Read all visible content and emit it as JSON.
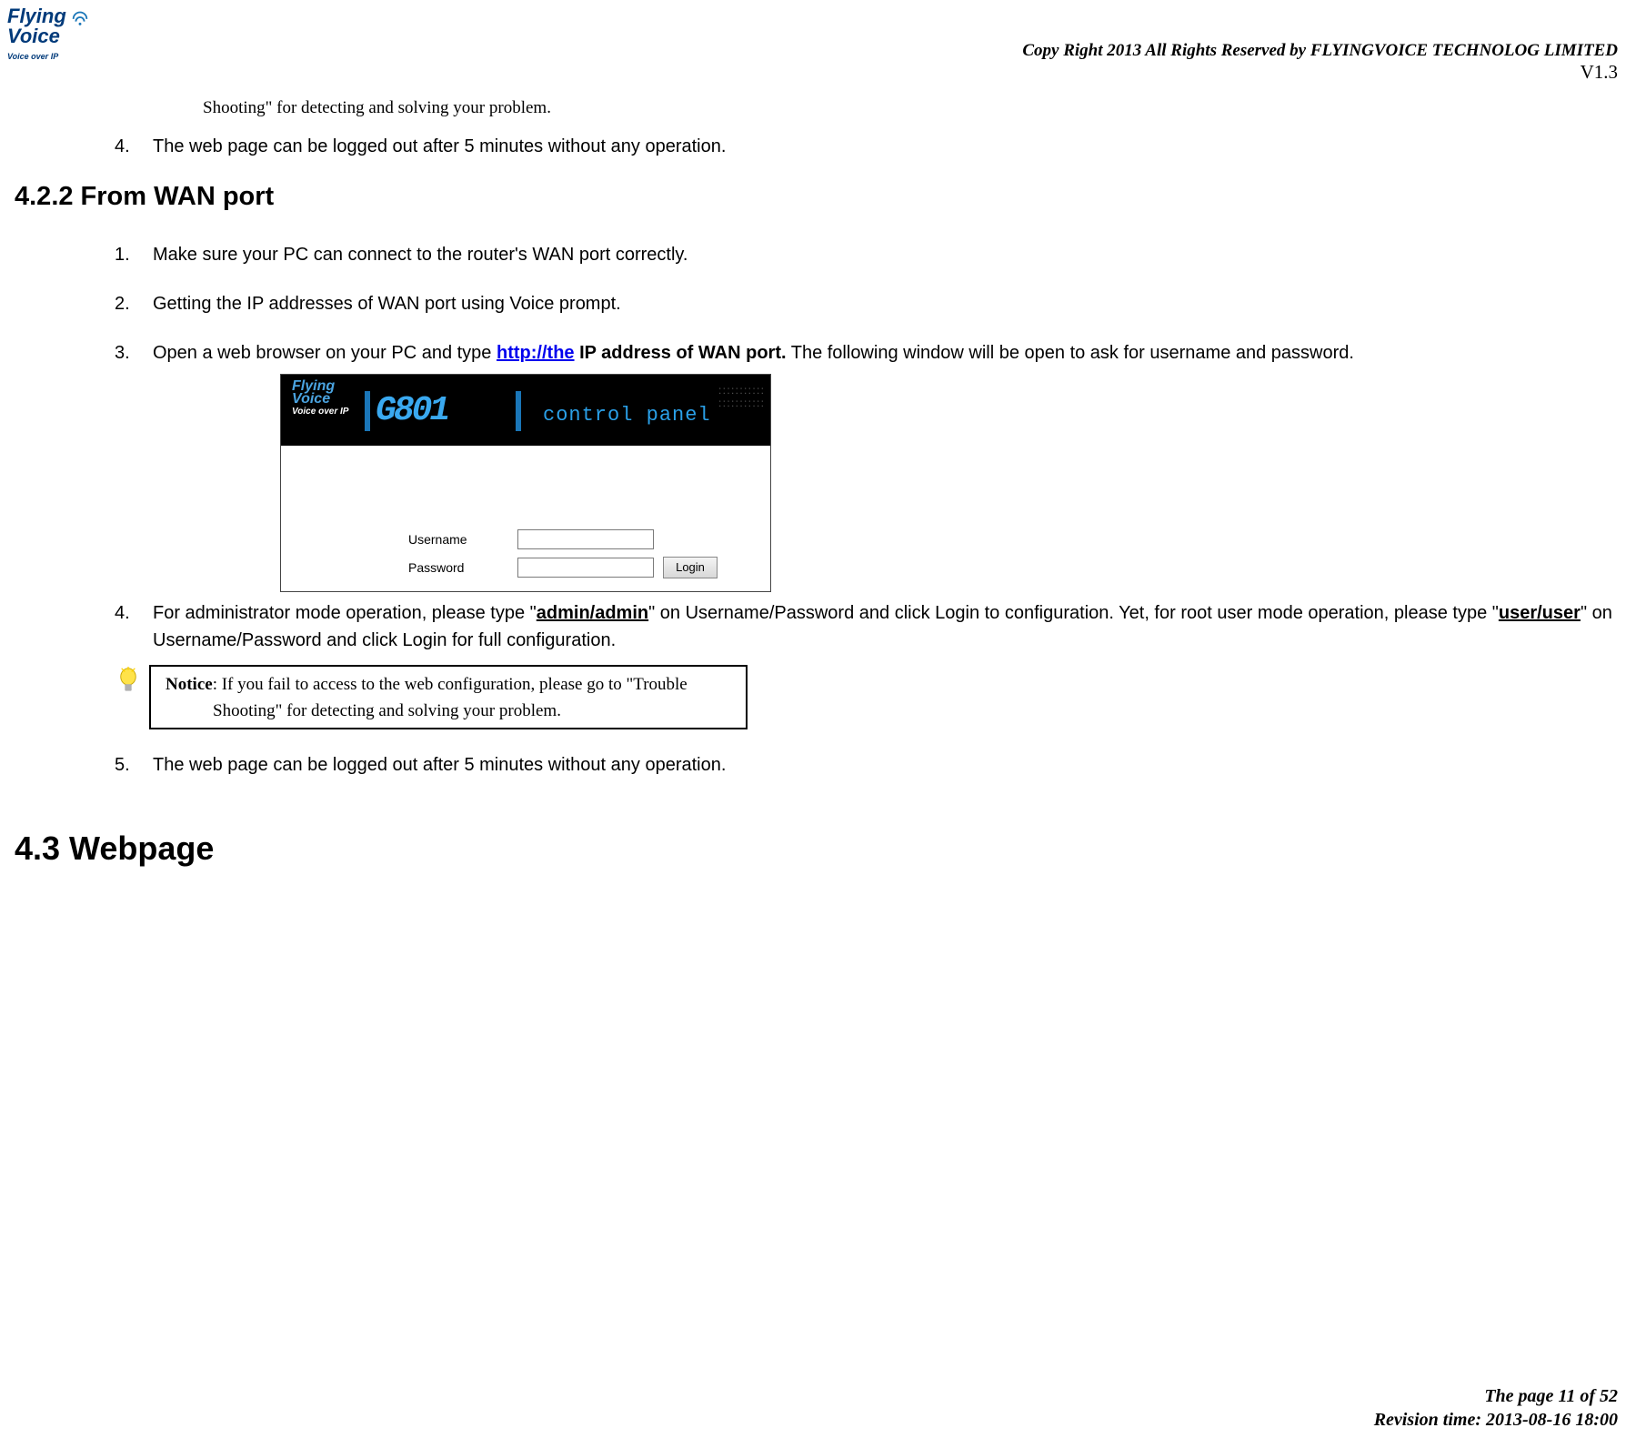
{
  "header": {
    "logo_line1": "Flying",
    "logo_line2": "Voice",
    "logo_sub": "Voice over IP",
    "copyright": "Copy Right 2013 All Rights Reserved by FLYINGVOICE TECHNOLOG LIMITED",
    "version": "V1.3"
  },
  "top_fragment": "Shooting\" for detecting and solving your problem.",
  "item4_top": {
    "num": "4.",
    "text": "The web page can be logged out after 5 minutes without any operation."
  },
  "section_title": "4.2.2 From WAN port",
  "wan_list": {
    "i1": {
      "num": "1.",
      "text": "Make sure your PC can connect to the router's WAN port correctly."
    },
    "i2": {
      "num": "2.",
      "text": "Getting the IP addresses of WAN port using Voice prompt."
    },
    "i3": {
      "num": "3.",
      "pre": "Open a web browser on your PC and type ",
      "link": "http://the",
      "mid": " IP address of WAN port.",
      "post": " The following window will be open to ask for username and password."
    },
    "i4": {
      "num": "4.",
      "pre": "For administrator mode operation, please type \"",
      "cred1": "admin/admin",
      "mid1": "\" on Username/Password and click Login to configuration. Yet, for root user mode operation, please type \"",
      "cred2": "user/user",
      "post": "\" on Username/Password and click Login for full configuration."
    },
    "i5": {
      "num": "5.",
      "text": "The web page can be logged out after 5 minutes without any operation."
    }
  },
  "panel": {
    "model": "G801",
    "title": "control panel",
    "username_label": "Username",
    "password_label": "Password",
    "login_btn": "Login"
  },
  "notice": {
    "label": "Notice",
    "line1": ": If you fail to access to the web configuration, please go to \"Trouble",
    "line2": "Shooting\" for detecting and solving your problem."
  },
  "section_43": "4.3 Webpage",
  "footer": {
    "page": "The page 11 of 52",
    "revision": "Revision time: 2013-08-16 18:00"
  }
}
